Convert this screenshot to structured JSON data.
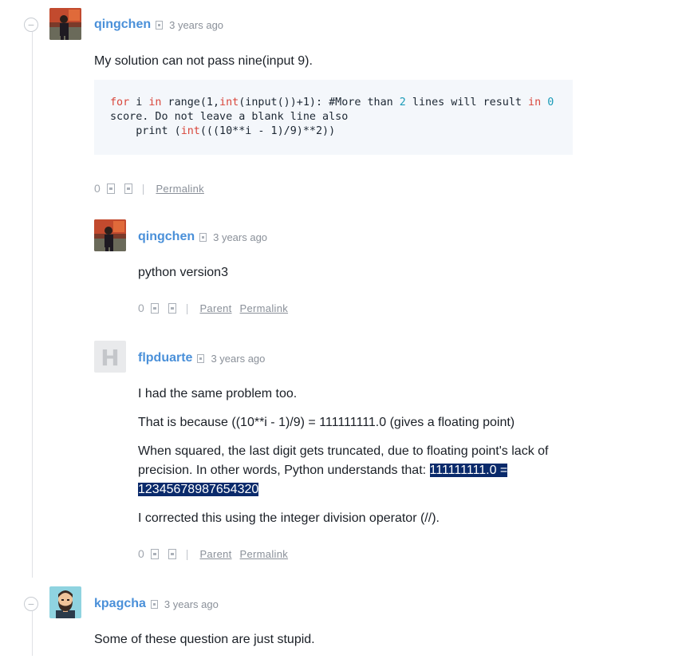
{
  "comments": [
    {
      "username": "qingchen",
      "time": "3 years ago",
      "collapse_icon": "−",
      "body": [
        "My solution can not pass nine(input 9)."
      ],
      "code": "for i in range(1,int(input())+1): #More than 2 lines will result in 0 score. Do not leave a blank line also\n    print (int(((10**i - 1)/9)**2))",
      "votes": "0",
      "actions": {
        "separator": "|",
        "permalink": "Permalink"
      },
      "replies": [
        {
          "username": "qingchen",
          "time": "3 years ago",
          "body": [
            "python version3"
          ],
          "votes": "0",
          "actions": {
            "separator": "|",
            "parent": "Parent",
            "permalink": "Permalink"
          }
        },
        {
          "username": "flpduarte",
          "time": "3 years ago",
          "avatar_letter": "H",
          "body": [
            "I had the same problem too.",
            "That is because ((10**i - 1)/9) = 111111111.0 (gives a floating point)",
            "When squared, the last digit gets truncated, due to floating point's lack of precision. In other words, Python understands that: ",
            "I corrected this using the integer division operator (//)."
          ],
          "highlighted": "111111111.0 = 12345678987654320",
          "votes": "0",
          "actions": {
            "separator": "|",
            "parent": "Parent",
            "permalink": "Permalink"
          }
        }
      ]
    },
    {
      "username": "kpagcha",
      "time": "3 years ago",
      "collapse_icon": "−",
      "body": [
        "Some of these question are just stupid."
      ]
    }
  ],
  "colors": {
    "username": "#4a90d9",
    "highlight": "#0a2a6b",
    "code_bg": "#f4f7fb"
  }
}
